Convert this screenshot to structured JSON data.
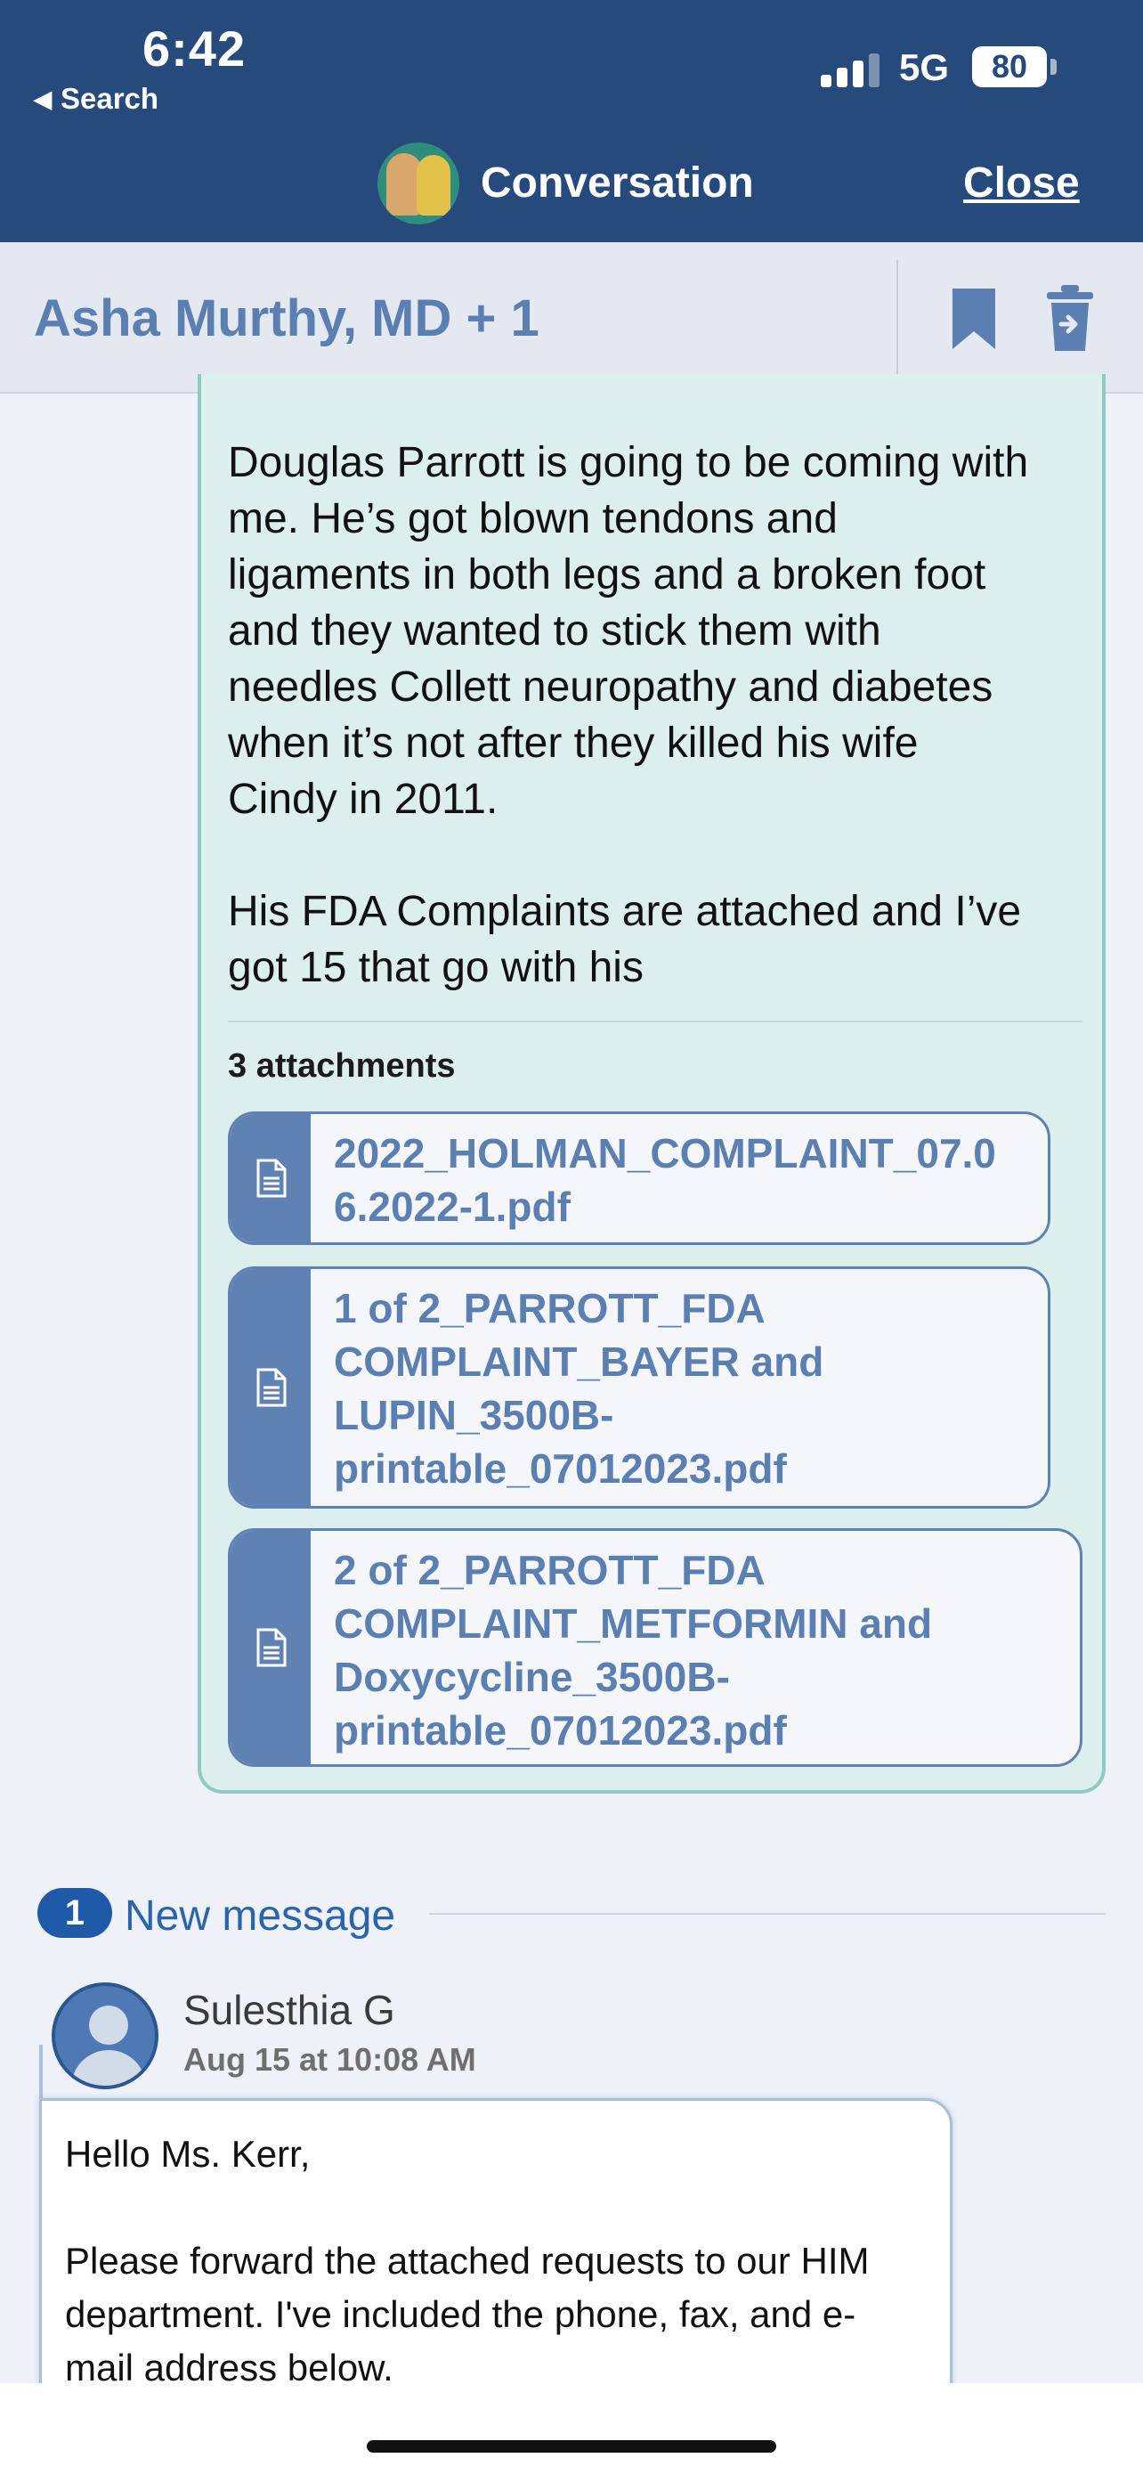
{
  "status_bar": {
    "time": "6:42",
    "back_app": "Search",
    "network": "5G",
    "battery": "80"
  },
  "nav": {
    "title": "Conversation",
    "close_label": "Close"
  },
  "conversation": {
    "participants": "Asha Murthy, MD + 1",
    "bookmark_icon": "bookmark-icon",
    "trash_icon": "move-to-trash-icon"
  },
  "message1": {
    "body": "Douglas Parrott is going to be coming with\nme. He’s got blown tendons and\nligaments in both legs and a broken foot\nand they wanted to stick them with\nneedles Collett neuropathy and diabetes\nwhen it’s not after they killed his wife\nCindy in 2011.\n\nHis FDA Complaints are attached and I’ve\ngot 15 that go with his",
    "attachments_label": "3 attachments",
    "attachments": [
      {
        "name": "2022_HOLMAN_COMPLAINT_07.06.2022-1.pdf"
      },
      {
        "name": "1 of 2_PARROTT_FDA COMPLAINT_BAYER and LUPIN_3500B-printable_07012023.pdf"
      },
      {
        "name": "2 of 2_PARROTT_FDA COMPLAINT_METFORMIN and Doxycycline_3500B-printable_07012023.pdf"
      }
    ]
  },
  "new_messages": {
    "count": "1",
    "label": "New message"
  },
  "message2": {
    "sender": "Sulesthia G",
    "time": "Aug 15 at 10:08 AM",
    "body": "Hello Ms. Kerr,\n\nPlease forward the attached requests to our HIM\ndepartment.  I've included the phone, fax, and e-\nmail address below."
  },
  "colors": {
    "nav_bg": "#254a7b",
    "accent_blue": "#5b7fb0",
    "bubble_bg": "#dcefec",
    "bubble_border": "#8fcac2",
    "badge_blue": "#1f5aa8"
  }
}
